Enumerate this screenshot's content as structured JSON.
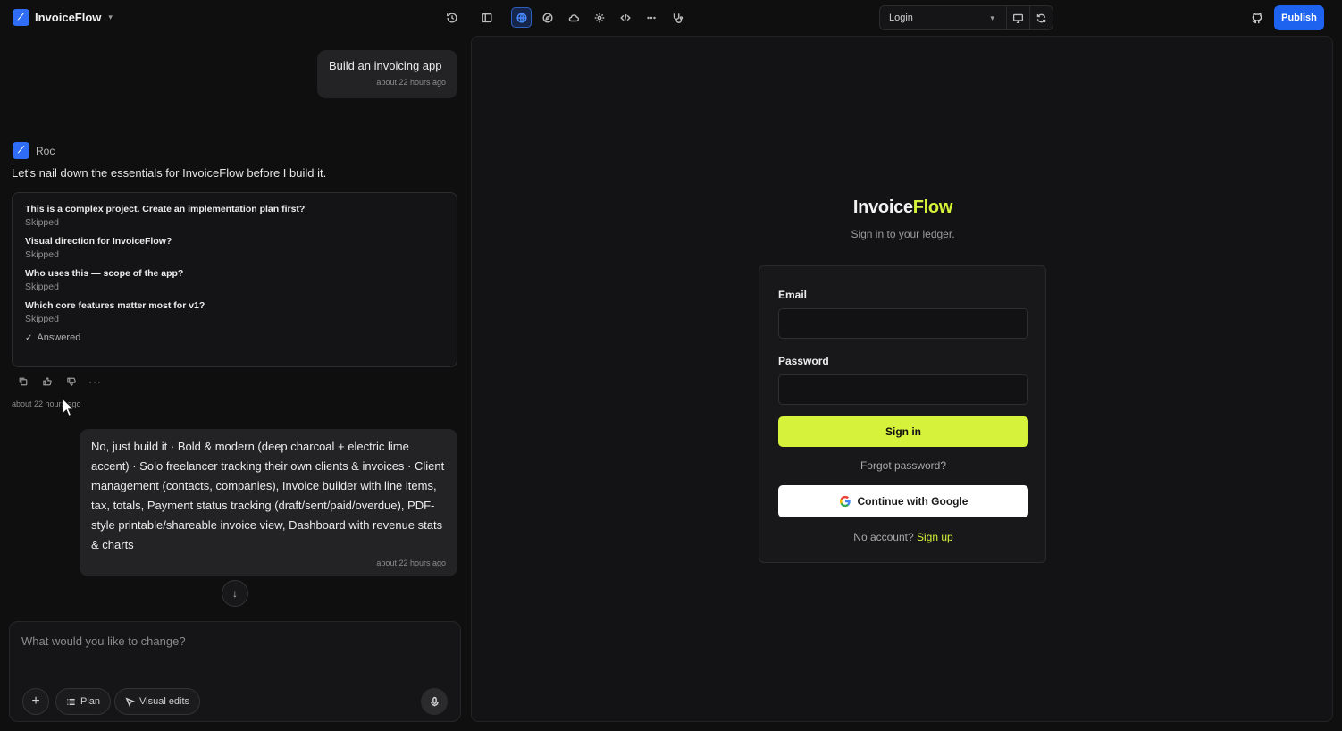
{
  "header": {
    "project_name": "InvoiceFlow",
    "route_select": "Login",
    "publish_label": "Publish"
  },
  "chat": {
    "messages": [
      {
        "role": "user",
        "text": "Build an invoicing app",
        "timestamp": "about 22 hours ago"
      },
      {
        "role": "assistant",
        "author": "Roc",
        "text": "Let's nail down the essentials for InvoiceFlow before I build it.",
        "questions": [
          {
            "question": "This is a complex project. Create an implementation plan first?",
            "status": "Skipped"
          },
          {
            "question": "Visual direction for InvoiceFlow?",
            "status": "Skipped"
          },
          {
            "question": "Who uses this — scope of the app?",
            "status": "Skipped"
          },
          {
            "question": "Which core features matter most for v1?",
            "status": "Skipped"
          }
        ],
        "answered_label": "Answered",
        "timestamp": "about 22 hours ago"
      },
      {
        "role": "user",
        "text": "No, just build it · Bold & modern (deep charcoal + electric lime accent) · Solo freelancer tracking their own clients & invoices · Client management (contacts, companies), Invoice builder with line items, tax, totals, Payment status tracking (draft/sent/paid/overdue), PDF-style printable/shareable invoice view, Dashboard with revenue stats & charts",
        "timestamp": "about 22 hours ago"
      }
    ],
    "composer": {
      "placeholder": "What would you like to change?",
      "plan_label": "Plan",
      "visual_edits_label": "Visual edits"
    }
  },
  "preview": {
    "title_main": "Invoice",
    "title_accent": "Flow",
    "subtitle": "Sign in to your ledger.",
    "email_label": "Email",
    "password_label": "Password",
    "sign_in_label": "Sign in",
    "forgot_label": "Forgot password?",
    "google_label": "Continue with Google",
    "no_account_text": "No account?",
    "sign_up_label": "Sign up"
  },
  "colors": {
    "accent": "#d6f23a",
    "brand_blue": "#1e63f0",
    "background": "#0f0f10"
  },
  "icons": {
    "toolbar": [
      "history-icon",
      "sidebar-toggle-icon",
      "globe-icon",
      "compass-icon",
      "cloud-icon",
      "settings-icon",
      "code-icon",
      "more-icon",
      "stethoscope-icon"
    ],
    "route": [
      "desktop-icon",
      "refresh-icon"
    ],
    "message_actions": [
      "copy-icon",
      "thumbs-up-icon",
      "thumbs-down-icon",
      "more-icon"
    ]
  }
}
